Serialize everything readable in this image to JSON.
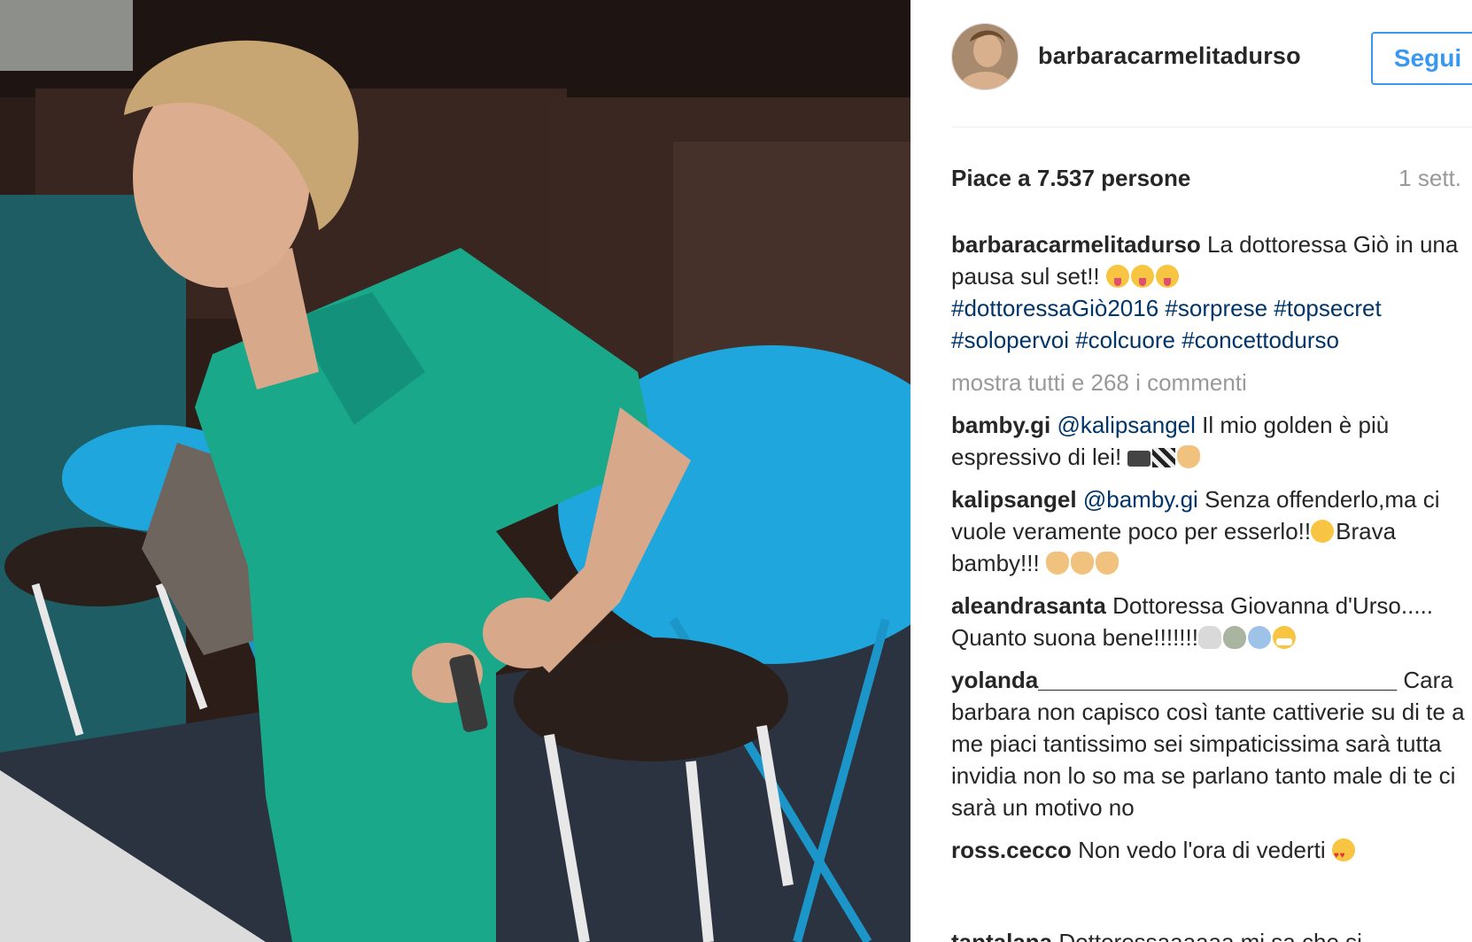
{
  "post": {
    "username": "barbaracarmelitadurso",
    "follow_label": "Segui",
    "likes_text": "Piace a 7.537 persone",
    "time_text": "1 sett."
  },
  "caption": {
    "user": "barbaracarmelitadurso",
    "text": "La dottoressa Giò in una pausa sul set!!",
    "emojis": [
      "tongue",
      "tongue",
      "tongue"
    ],
    "tags": [
      "#dottoressaGiò2016",
      "#sorprese",
      "#topsecret",
      "#solopervoi",
      "#colcuore",
      "#concettodurso"
    ]
  },
  "more_comments": "mostra tutti e 268 i commenti",
  "comments": [
    {
      "user": "bamby.gi",
      "mention": "@kalipsangel",
      "text": "Il mio golden è più espressivo di lei!",
      "emojis": [
        "camera",
        "clapper",
        "thumbs-down"
      ]
    },
    {
      "user": "kalipsangel",
      "mention": "@bamby.gi",
      "text": "Senza offenderlo,ma ci vuole veramente poco per esserlo!!",
      "text2": "Brava bamby!!!",
      "emojis": [
        "smile"
      ],
      "emojis2": [
        "clap",
        "thumbs-up",
        "clap"
      ]
    },
    {
      "user": "aleandrasanta",
      "mention": "",
      "text": "Dottoressa Giovanna d'Urso..... Quanto suona bene!!!!!!!",
      "emojis": [
        "skull",
        "alien",
        "scream",
        "mask"
      ]
    },
    {
      "user": "yolanda____________________________",
      "mention": "",
      "text": "Cara barbara non capisco così tante cattiverie su di te a me piaci tantissimo sei simpaticissima sarà tutta invidia non lo so ma se parlano tanto male di te ci sarà un motivo no",
      "emojis": []
    },
    {
      "user": "ross.cecco",
      "mention": "",
      "text": "Non vedo l'ora di vederti",
      "emojis": [
        "heart-eyes"
      ]
    }
  ],
  "partial_comment": {
    "user": "tantalana",
    "text": "Dottoressaaaaaa mi sa che si"
  },
  "colors": {
    "follow_blue": "#3897f0",
    "hashtag_blue": "#003569",
    "muted_gray": "#999999",
    "text_dark": "#262626",
    "scrubs_teal": "#19a98a",
    "table_blue": "#1fa6dc"
  }
}
